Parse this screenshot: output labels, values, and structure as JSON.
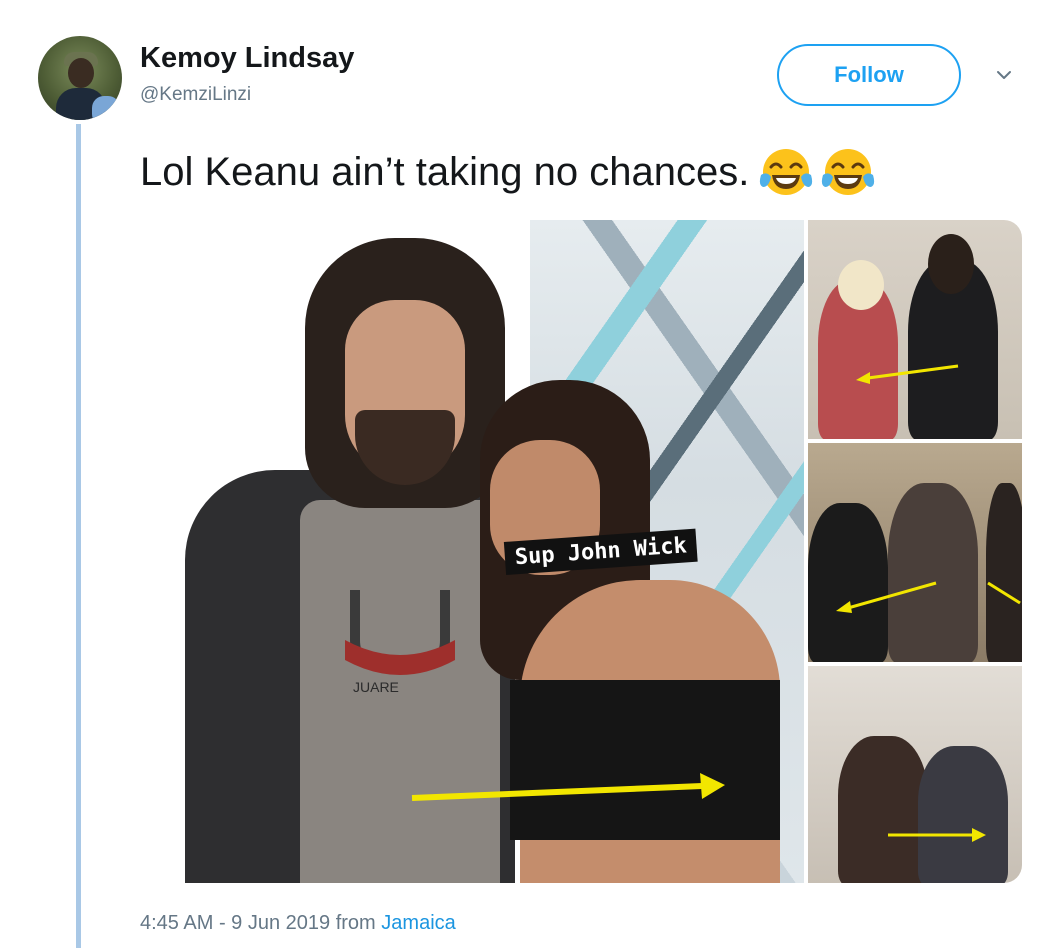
{
  "tweet": {
    "author_name": "Kemoy Lindsay",
    "author_handle": "@KemziLinzi",
    "follow_label": "Follow",
    "text": "Lol Keanu ain’t taking no chances.",
    "emojis": [
      "face-with-tears-of-joy",
      "face-with-tears-of-joy"
    ],
    "media": {
      "caption_sticker": "Sup John Wick",
      "shirt_print": "JUARE"
    },
    "time": "4:45 AM",
    "date_separator": " - ",
    "date": "9 Jun 2019",
    "from_label": " from ",
    "location": "Jamaica"
  },
  "colors": {
    "accent": "#1da1f2",
    "muted": "#657786",
    "thread_line": "#a9c8e6",
    "arrow": "#f2e600"
  }
}
